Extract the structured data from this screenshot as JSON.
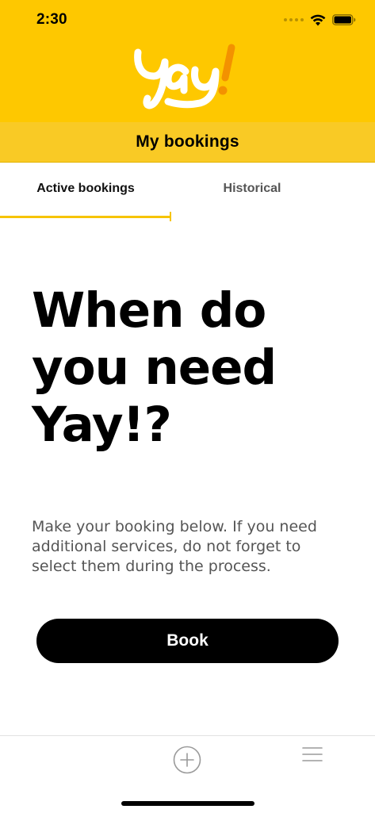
{
  "status_bar": {
    "time": "2:30",
    "icons": [
      "signal-dots-icon",
      "wifi-icon",
      "battery-icon"
    ]
  },
  "header": {
    "logo_text": "Yay!",
    "title": "My bookings",
    "colors": {
      "brand_yellow": "#FEC800",
      "title_bar_yellow": "#F9CA25",
      "logo_exclamation": "#F39200"
    }
  },
  "tabs": [
    {
      "label": "Active bookings",
      "active": true
    },
    {
      "label": "Historical",
      "active": false
    }
  ],
  "main": {
    "headline": "When do you need Yay!?",
    "description": "Make your booking below. If you need additional services, do not forget to select them during the process.",
    "book_button_label": "Book"
  },
  "bottom_bar": {
    "icons": [
      "add-circle-icon",
      "menu-icon"
    ]
  }
}
